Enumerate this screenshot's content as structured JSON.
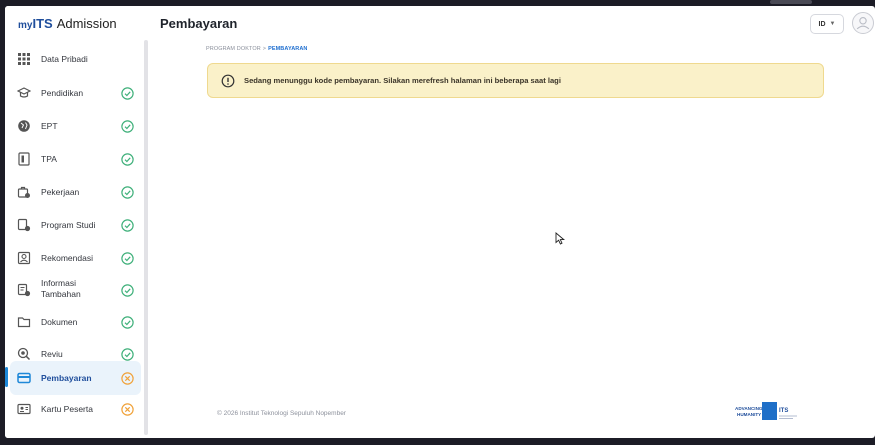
{
  "brand": {
    "my": "my",
    "its": "ITS",
    "app": "Admission"
  },
  "header": {
    "title": "Pembayaran",
    "language": "ID"
  },
  "breadcrumb": {
    "parent": "PROGRAM DOKTOR",
    "separator": ">",
    "current": "PEMBAYARAN"
  },
  "alert": {
    "message": "Sedang menunggu kode pembayaran. Silakan merefresh halaman ini beberapa saat lagi",
    "icon": "info-circle-icon"
  },
  "sidebar": {
    "items": [
      {
        "label": "Data Pribadi",
        "icon": "grid-icon",
        "status": "none"
      },
      {
        "label": "Pendidikan",
        "icon": "graduation-cap-icon",
        "status": "done"
      },
      {
        "label": "EPT",
        "icon": "globe-language-icon",
        "status": "done"
      },
      {
        "label": "TPA",
        "icon": "document-icon",
        "status": "done"
      },
      {
        "label": "Pekerjaan",
        "icon": "briefcase-icon",
        "status": "done"
      },
      {
        "label": "Program Studi",
        "icon": "program-icon",
        "status": "done"
      },
      {
        "label": "Rekomendasi",
        "icon": "recommendation-icon",
        "status": "done"
      },
      {
        "label": "Informasi Tambahan",
        "icon": "info-doc-icon",
        "status": "done"
      },
      {
        "label": "Dokumen",
        "icon": "folder-icon",
        "status": "done"
      },
      {
        "label": "Reviu",
        "icon": "review-icon",
        "status": "done"
      },
      {
        "label": "Pembayaran",
        "icon": "payment-card-icon",
        "status": "pending",
        "active": true
      },
      {
        "label": "Kartu Peserta",
        "icon": "id-card-icon",
        "status": "pending"
      }
    ]
  },
  "footer": {
    "copyright": "© 2026 Institut Teknologi Sepuluh Nopember",
    "logo_text": "ADVANCING HUMANITY",
    "logo_abbr": "ITS"
  },
  "colors": {
    "done": "#3fb07a",
    "pending": "#f0a23a",
    "accent": "#1f4e9c",
    "alert_bg": "#faf1c9"
  }
}
